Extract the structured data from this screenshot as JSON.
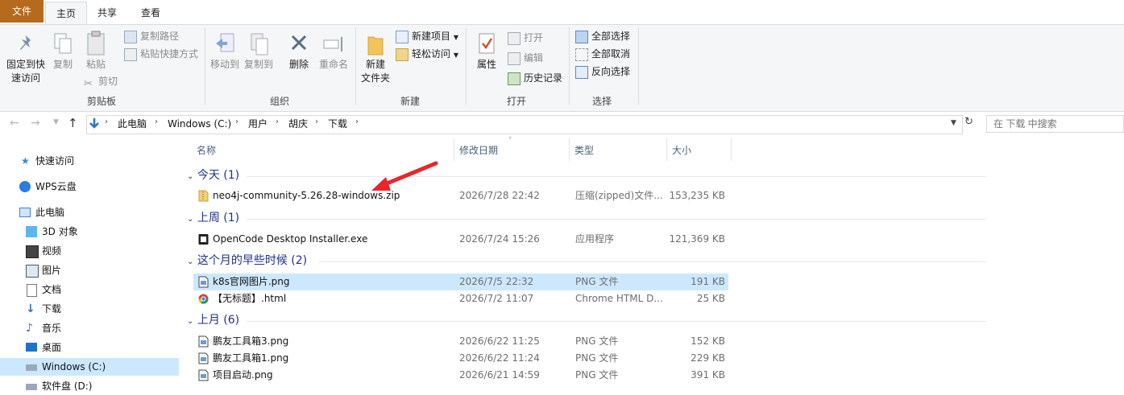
{
  "ribbon_tabs": {
    "file": "文件",
    "home": "主页",
    "share": "共享",
    "view": "查看"
  },
  "clipboard": {
    "pin": "固定到快\n速访问",
    "copy": "复制",
    "paste": "粘贴",
    "copy_path": "复制路径",
    "paste_shortcut": "粘贴快捷方式",
    "cut": "剪切",
    "label": "剪贴板"
  },
  "organize": {
    "move_to": "移动到",
    "copy_to": "复制到",
    "delete": "删除",
    "rename": "重命名",
    "label": "组织"
  },
  "new_group": {
    "new_folder": "新建\n文件夹",
    "new_item": "新建项目",
    "easy_access": "轻松访问",
    "label": "新建"
  },
  "open_group": {
    "properties": "属性",
    "open": "打开",
    "edit": "编辑",
    "history": "历史记录",
    "label": "打开"
  },
  "select_group": {
    "select_all": "全部选择",
    "select_none": "全部取消",
    "invert": "反向选择",
    "label": "选择"
  },
  "address": {
    "crumbs": [
      "此电脑",
      "Windows (C:)",
      "用户",
      "胡庆",
      "下载"
    ]
  },
  "search": {
    "placeholder": "在 下载 中搜索"
  },
  "nav": [
    {
      "label": "快速访问"
    },
    {
      "label": "WPS云盘"
    },
    {
      "label": "此电脑"
    },
    {
      "label": "3D 对象"
    },
    {
      "label": "视频"
    },
    {
      "label": "图片"
    },
    {
      "label": "文档"
    },
    {
      "label": "下载"
    },
    {
      "label": "音乐"
    },
    {
      "label": "桌面"
    },
    {
      "label": "Windows (C:)"
    },
    {
      "label": "软件盘 (D:)"
    }
  ],
  "columns": {
    "name": "名称",
    "date": "修改日期",
    "type": "类型",
    "size": "大小"
  },
  "groups": [
    {
      "title": "今天 (1)"
    },
    {
      "title": "上周 (1)"
    },
    {
      "title": "这个月的早些时候 (2)"
    },
    {
      "title": "上月 (6)"
    }
  ],
  "files": [
    {
      "name": "neo4j-community-5.26.28-windows.zip",
      "date": "2026/7/28 22:42",
      "type": "压缩(zipped)文件...",
      "size": "153,235 KB"
    },
    {
      "name": "OpenCode Desktop Installer.exe",
      "date": "2026/7/24 15:26",
      "type": "应用程序",
      "size": "121,369 KB"
    },
    {
      "name": "k8s官网图片.png",
      "date": "2026/7/5 22:32",
      "type": "PNG 文件",
      "size": "191 KB"
    },
    {
      "name": "【无标题】.html",
      "date": "2026/7/2 11:07",
      "type": "Chrome HTML D...",
      "size": "25 KB"
    },
    {
      "name": "鹏友工具箱3.png",
      "date": "2026/6/22 11:25",
      "type": "PNG 文件",
      "size": "152 KB"
    },
    {
      "name": "鹏友工具箱1.png",
      "date": "2026/6/22 11:24",
      "type": "PNG 文件",
      "size": "229 KB"
    },
    {
      "name": "项目启动.png",
      "date": "2026/6/21 14:59",
      "type": "PNG 文件",
      "size": "391 KB"
    }
  ],
  "colors": {
    "file_tab": "#b56a1d",
    "selection": "#cce8ff",
    "group_header": "#1e3287",
    "arrow": "#e8262b"
  }
}
